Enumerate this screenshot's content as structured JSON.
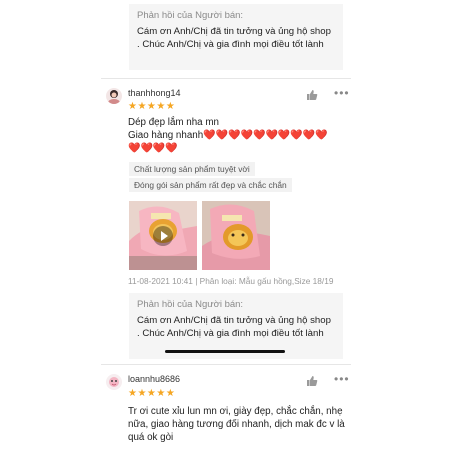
{
  "reply_1": {
    "title": "Phản hồi của Người bán:",
    "text": "Cám ơn Anh/Chị đã tin tưởng và ủng hộ shop . Chúc Anh/Chị và gia đình mọi điều tốt lành"
  },
  "review_1": {
    "username": "thanhhong14",
    "stars": "★★★★★",
    "line1": "Dép đẹp lắm nha mn",
    "line2": "Giao hàng nhanh",
    "hearts_a": "❤️❤️❤️❤️❤️❤️❤️❤️❤️❤️",
    "hearts_b": "❤️❤️❤️❤️",
    "tags": [
      "Chất lượng sản phẩm tuyệt vời",
      "Đóng gói sản phẩm rất đẹp và chắc chắn"
    ],
    "meta": "11-08-2021 10:41 | Phân loại: Mẫu gấu hồng,Size 18/19"
  },
  "reply_2": {
    "title": "Phản hồi của Người bán:",
    "text": "Cám ơn Anh/Chị đã tin tưởng và ủng hộ shop . Chúc Anh/Chị và gia đình mọi điều tốt lành"
  },
  "review_2": {
    "username": "loannhu8686",
    "stars": "★★★★★",
    "text": "Tr ơi cute xỉu lun mn ơi, giày đẹp, chắc chắn, nhẹ nữa, giao hàng tương đối nhanh, dịch mak đc v là quá ok gòi"
  },
  "icons": {
    "like": "thumbs-up-icon",
    "more": "more-icon",
    "play": "play-icon",
    "star": "star-icon"
  },
  "colors": {
    "star": "#f5a623",
    "heart": "#e02424",
    "muted": "#8a8a8a",
    "reply_bg": "#f5f5f5"
  }
}
